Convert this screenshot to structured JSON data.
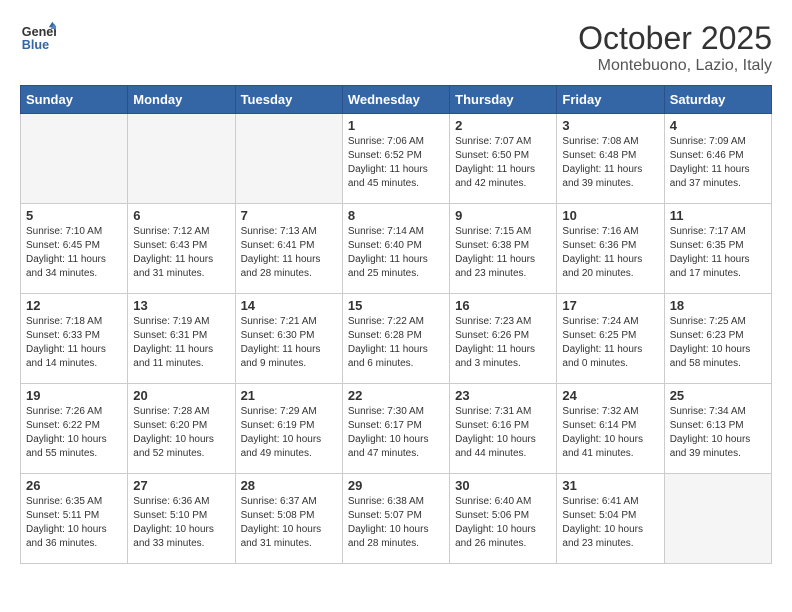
{
  "header": {
    "logo_line1": "General",
    "logo_line2": "Blue",
    "month": "October 2025",
    "location": "Montebuono, Lazio, Italy"
  },
  "days_of_week": [
    "Sunday",
    "Monday",
    "Tuesday",
    "Wednesday",
    "Thursday",
    "Friday",
    "Saturday"
  ],
  "weeks": [
    [
      {
        "num": "",
        "info": ""
      },
      {
        "num": "",
        "info": ""
      },
      {
        "num": "",
        "info": ""
      },
      {
        "num": "1",
        "info": "Sunrise: 7:06 AM\nSunset: 6:52 PM\nDaylight: 11 hours and 45 minutes."
      },
      {
        "num": "2",
        "info": "Sunrise: 7:07 AM\nSunset: 6:50 PM\nDaylight: 11 hours and 42 minutes."
      },
      {
        "num": "3",
        "info": "Sunrise: 7:08 AM\nSunset: 6:48 PM\nDaylight: 11 hours and 39 minutes."
      },
      {
        "num": "4",
        "info": "Sunrise: 7:09 AM\nSunset: 6:46 PM\nDaylight: 11 hours and 37 minutes."
      }
    ],
    [
      {
        "num": "5",
        "info": "Sunrise: 7:10 AM\nSunset: 6:45 PM\nDaylight: 11 hours and 34 minutes."
      },
      {
        "num": "6",
        "info": "Sunrise: 7:12 AM\nSunset: 6:43 PM\nDaylight: 11 hours and 31 minutes."
      },
      {
        "num": "7",
        "info": "Sunrise: 7:13 AM\nSunset: 6:41 PM\nDaylight: 11 hours and 28 minutes."
      },
      {
        "num": "8",
        "info": "Sunrise: 7:14 AM\nSunset: 6:40 PM\nDaylight: 11 hours and 25 minutes."
      },
      {
        "num": "9",
        "info": "Sunrise: 7:15 AM\nSunset: 6:38 PM\nDaylight: 11 hours and 23 minutes."
      },
      {
        "num": "10",
        "info": "Sunrise: 7:16 AM\nSunset: 6:36 PM\nDaylight: 11 hours and 20 minutes."
      },
      {
        "num": "11",
        "info": "Sunrise: 7:17 AM\nSunset: 6:35 PM\nDaylight: 11 hours and 17 minutes."
      }
    ],
    [
      {
        "num": "12",
        "info": "Sunrise: 7:18 AM\nSunset: 6:33 PM\nDaylight: 11 hours and 14 minutes."
      },
      {
        "num": "13",
        "info": "Sunrise: 7:19 AM\nSunset: 6:31 PM\nDaylight: 11 hours and 11 minutes."
      },
      {
        "num": "14",
        "info": "Sunrise: 7:21 AM\nSunset: 6:30 PM\nDaylight: 11 hours and 9 minutes."
      },
      {
        "num": "15",
        "info": "Sunrise: 7:22 AM\nSunset: 6:28 PM\nDaylight: 11 hours and 6 minutes."
      },
      {
        "num": "16",
        "info": "Sunrise: 7:23 AM\nSunset: 6:26 PM\nDaylight: 11 hours and 3 minutes."
      },
      {
        "num": "17",
        "info": "Sunrise: 7:24 AM\nSunset: 6:25 PM\nDaylight: 11 hours and 0 minutes."
      },
      {
        "num": "18",
        "info": "Sunrise: 7:25 AM\nSunset: 6:23 PM\nDaylight: 10 hours and 58 minutes."
      }
    ],
    [
      {
        "num": "19",
        "info": "Sunrise: 7:26 AM\nSunset: 6:22 PM\nDaylight: 10 hours and 55 minutes."
      },
      {
        "num": "20",
        "info": "Sunrise: 7:28 AM\nSunset: 6:20 PM\nDaylight: 10 hours and 52 minutes."
      },
      {
        "num": "21",
        "info": "Sunrise: 7:29 AM\nSunset: 6:19 PM\nDaylight: 10 hours and 49 minutes."
      },
      {
        "num": "22",
        "info": "Sunrise: 7:30 AM\nSunset: 6:17 PM\nDaylight: 10 hours and 47 minutes."
      },
      {
        "num": "23",
        "info": "Sunrise: 7:31 AM\nSunset: 6:16 PM\nDaylight: 10 hours and 44 minutes."
      },
      {
        "num": "24",
        "info": "Sunrise: 7:32 AM\nSunset: 6:14 PM\nDaylight: 10 hours and 41 minutes."
      },
      {
        "num": "25",
        "info": "Sunrise: 7:34 AM\nSunset: 6:13 PM\nDaylight: 10 hours and 39 minutes."
      }
    ],
    [
      {
        "num": "26",
        "info": "Sunrise: 6:35 AM\nSunset: 5:11 PM\nDaylight: 10 hours and 36 minutes."
      },
      {
        "num": "27",
        "info": "Sunrise: 6:36 AM\nSunset: 5:10 PM\nDaylight: 10 hours and 33 minutes."
      },
      {
        "num": "28",
        "info": "Sunrise: 6:37 AM\nSunset: 5:08 PM\nDaylight: 10 hours and 31 minutes."
      },
      {
        "num": "29",
        "info": "Sunrise: 6:38 AM\nSunset: 5:07 PM\nDaylight: 10 hours and 28 minutes."
      },
      {
        "num": "30",
        "info": "Sunrise: 6:40 AM\nSunset: 5:06 PM\nDaylight: 10 hours and 26 minutes."
      },
      {
        "num": "31",
        "info": "Sunrise: 6:41 AM\nSunset: 5:04 PM\nDaylight: 10 hours and 23 minutes."
      },
      {
        "num": "",
        "info": ""
      }
    ]
  ]
}
